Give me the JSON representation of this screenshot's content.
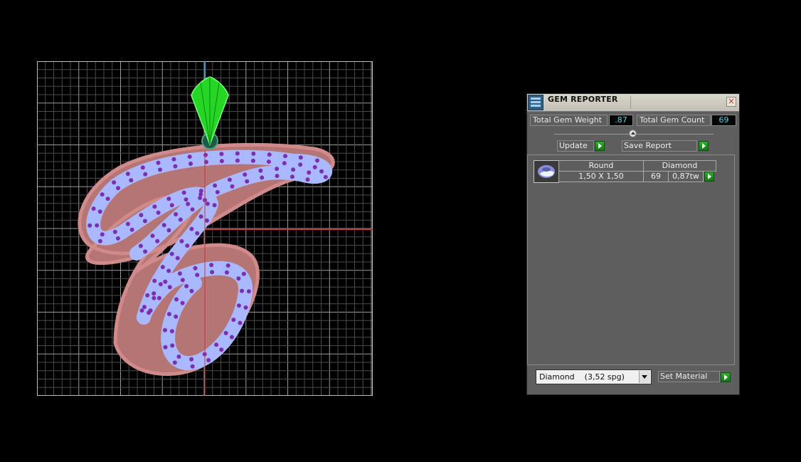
{
  "panel": {
    "title": "GEM REPORTER",
    "close_label": "×",
    "total_weight_label": "Total Gem Weight",
    "total_weight_value": ".87",
    "total_count_label": "Total Gem Count",
    "total_count_value": "69",
    "update_label": "Update",
    "save_report_label": "Save Report"
  },
  "gem_table": {
    "headers": [
      "Round",
      "Diamond"
    ],
    "rows": [
      {
        "size": "1,50 X 1,50",
        "count": "69",
        "weight": "0,87tw"
      }
    ]
  },
  "material": {
    "selected": "Diamond    (3,52 spg)",
    "set_label": "Set Material"
  },
  "colors": {
    "background": "#000000",
    "grid": "#8a8a8a",
    "letter_fill": "#b57575",
    "gem_path": "#aab8ff",
    "gem_bead": "#7b2fb0",
    "pointer": "#25d625",
    "panel_bg": "#5e5e5e",
    "value_text": "#59c9e8"
  }
}
